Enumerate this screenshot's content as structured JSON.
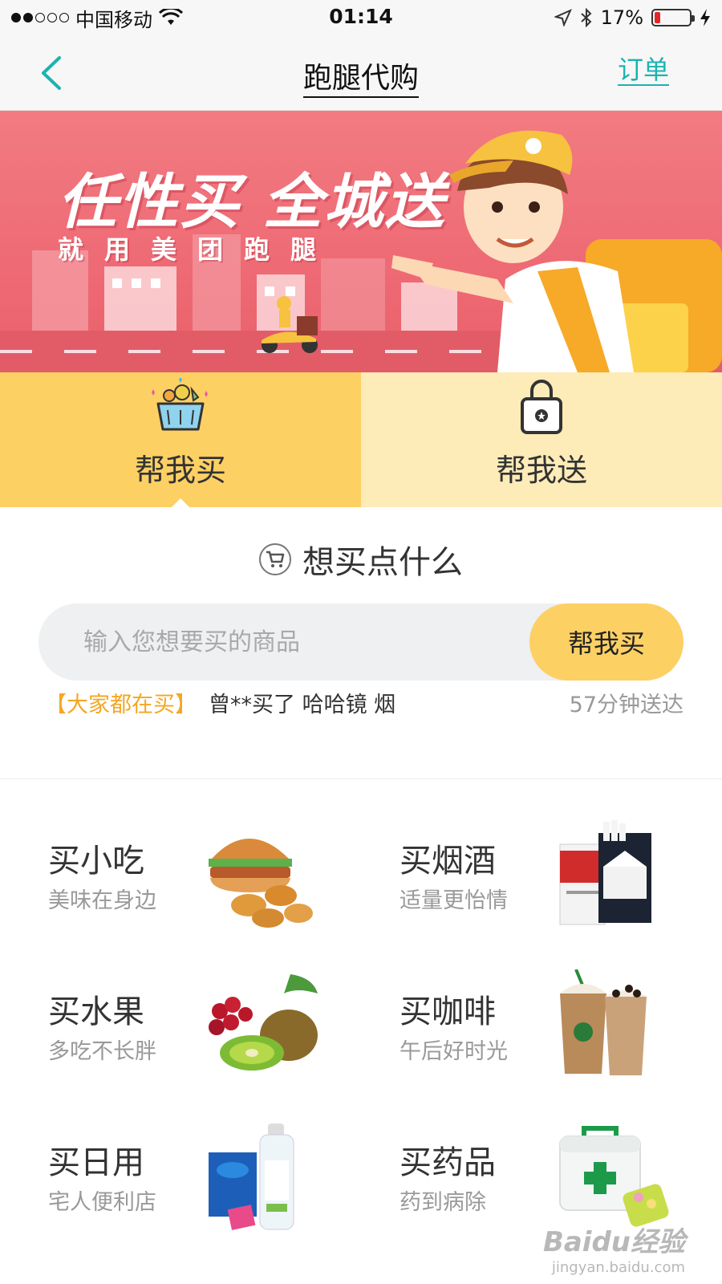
{
  "status_bar": {
    "carrier": "中国移动",
    "time": "01:14",
    "battery": "17%",
    "battery_level": 0.17
  },
  "nav": {
    "title": "跑腿代购",
    "order_label": "订单"
  },
  "banner": {
    "title": "任性买 全城送",
    "subtitle": "就用美团跑腿"
  },
  "tabs": [
    {
      "label": "帮我买",
      "icon": "basket-icon",
      "active": true
    },
    {
      "label": "帮我送",
      "icon": "lock-bag-icon",
      "active": false
    }
  ],
  "buy": {
    "heading": "想买点什么",
    "search_placeholder": "输入您想要买的商品",
    "search_button": "帮我买",
    "ticker_tag": "【大家都在买】",
    "ticker_text": "曾**买了 哈哈镜 烟",
    "ticker_time": "57分钟送达"
  },
  "categories": [
    {
      "title": "买小吃",
      "subtitle": "美味在身边",
      "image": "burger-nuggets"
    },
    {
      "title": "买烟酒",
      "subtitle": "适量更怡情",
      "image": "cigarettes"
    },
    {
      "title": "买水果",
      "subtitle": "多吃不长胖",
      "image": "fruit"
    },
    {
      "title": "买咖啡",
      "subtitle": "午后好时光",
      "image": "coffee"
    },
    {
      "title": "买日用",
      "subtitle": "宅人便利店",
      "image": "daily-goods"
    },
    {
      "title": "买药品",
      "subtitle": "药到病除",
      "image": "medicine-box"
    }
  ],
  "watermark": {
    "main": "Baidu经验",
    "sub": "jingyan.baidu.com"
  },
  "colors": {
    "accent_yellow": "#fdd064",
    "light_yellow": "#fdebb8",
    "teal": "#1cb3b0",
    "banner_red": "#ee6a74",
    "ticker_orange": "#f5a623"
  }
}
